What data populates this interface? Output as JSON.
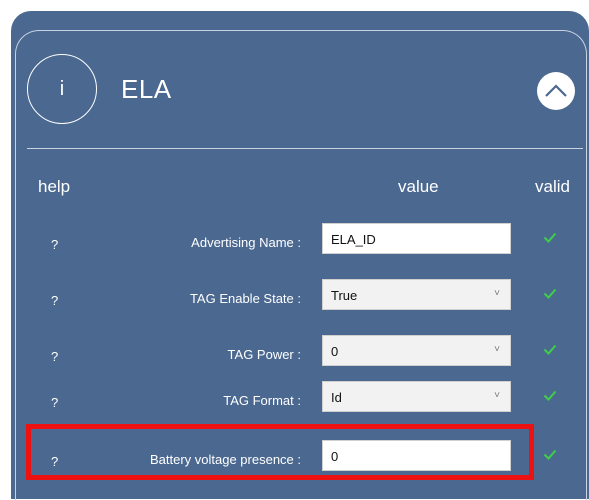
{
  "panel": {
    "info_glyph": "i",
    "title": "ELA",
    "collapse_icon": "chevron-up-icon"
  },
  "columns": {
    "help": "help",
    "value": "value",
    "valid": "valid"
  },
  "rows": [
    {
      "help": "?",
      "label": "Advertising Name :",
      "value": "ELA_ID",
      "type": "text",
      "valid_icon": "checkmark-icon"
    },
    {
      "help": "?",
      "label": "TAG Enable State :",
      "value": "True",
      "type": "select",
      "valid_icon": "checkmark-icon"
    },
    {
      "help": "?",
      "label": "TAG Power :",
      "value": "0",
      "type": "select",
      "valid_icon": "checkmark-icon"
    },
    {
      "help": "?",
      "label": "TAG Format :",
      "value": "Id",
      "type": "select",
      "valid_icon": "checkmark-icon"
    },
    {
      "help": "?",
      "label": "Battery voltage presence :",
      "value": "0",
      "type": "text",
      "valid_icon": "checkmark-icon"
    }
  ],
  "colors": {
    "panel_bg": "#4a6890",
    "check": "#3fcf47",
    "highlight": "#ee1111"
  }
}
